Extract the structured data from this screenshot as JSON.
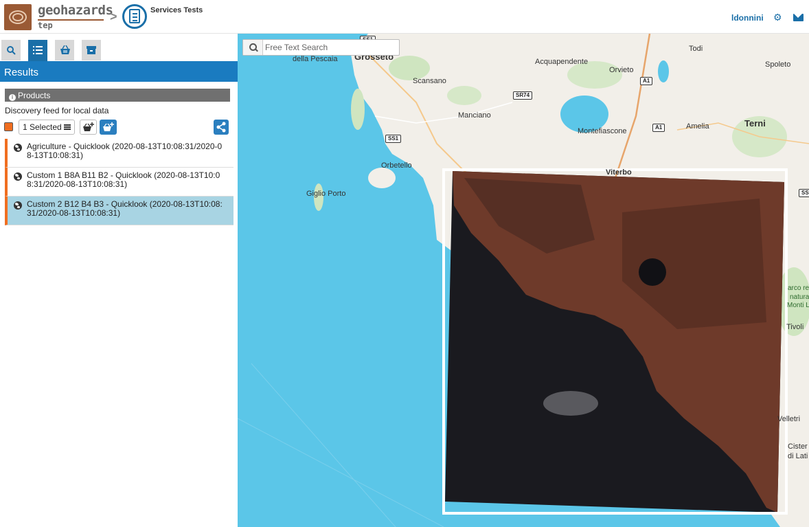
{
  "header": {
    "brand": "geohazards",
    "brand_sub": "tep",
    "breadcrumb_sep": ">",
    "service_title": "Services Tests",
    "username": "ldonnini",
    "accent_color": "#1a6fa8"
  },
  "left_panel": {
    "tabs": [
      {
        "name": "search",
        "icon": "search-icon",
        "active": false
      },
      {
        "name": "results",
        "icon": "list-icon",
        "active": true
      },
      {
        "name": "basket",
        "icon": "basket-icon",
        "active": false
      },
      {
        "name": "archive",
        "icon": "archive-icon",
        "active": false
      }
    ],
    "results_title": "Results",
    "products_header": "Products",
    "feed_description": "Discovery feed for local data",
    "selected_label": "1 Selected",
    "items": [
      {
        "label": "Agriculture - Quicklook (2020-08-13T10:08:31/2020-0 8-13T10:08:31)",
        "line1": "Agriculture - Quicklook (2020-08-13T10:08:31/2020-0",
        "line2": "8-13T10:08:31)",
        "selected": false
      },
      {
        "label": "Custom 1 B8A B11 B2 - Quicklook (2020-08-13T10:0 8:31/2020-08-13T10:08:31)",
        "line1": "Custom 1 B8A B11 B2 - Quicklook (2020-08-13T10:0",
        "line2": "8:31/2020-08-13T10:08:31)",
        "selected": false
      },
      {
        "label": "Custom 2 B12 B4 B3 - Quicklook (2020-08-13T10:08: 31/2020-08-13T10:08:31)",
        "line1": "Custom 2 B12 B4 B3 - Quicklook (2020-08-13T10:08:",
        "line2": "31/2020-08-13T10:08:31)",
        "selected": true
      }
    ]
  },
  "map": {
    "search_placeholder": "Free Text Search",
    "labels": {
      "grosseto": "Grosseto",
      "della_pescaia": "della Pescaia",
      "todi": "Todi",
      "spoleto": "Spoleto",
      "acquapendente": "Acquapendente",
      "orvieto": "Orvieto",
      "scansano": "Scansano",
      "manciano": "Manciano",
      "montefiascone": "Montefiascone",
      "amelia": "Amelia",
      "terni": "Terni",
      "orbetello": "Orbetello",
      "giglio_porto": "Giglio Porto",
      "viterbo": "Viterbo",
      "tivoli": "Tivoli",
      "velletri": "Velletri",
      "cisterna": "Cister",
      "cisterna2": "di Lati",
      "parco1": "arco re",
      "parco2": "natura",
      "parco3": "Monti L"
    },
    "shields": {
      "ss1_top": "SS1",
      "a1_a": "A1",
      "sr74": "SR74",
      "ss1": "SS1",
      "a1_b": "A1",
      "ss_right": "SS"
    },
    "sea_color": "#5bc6e8",
    "land_color": "#f2efe9"
  }
}
